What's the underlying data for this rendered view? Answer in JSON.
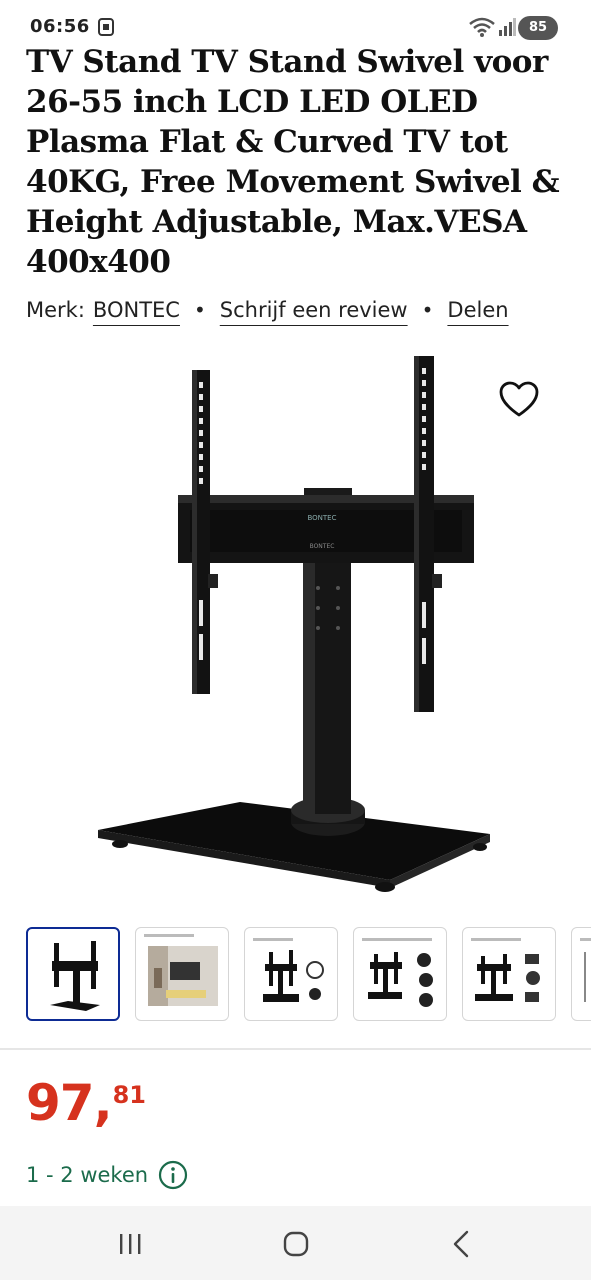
{
  "status_bar": {
    "time": "06:56",
    "battery": "85",
    "icons": [
      "sim-icon",
      "wifi-icon",
      "signal-icon",
      "battery-icon"
    ]
  },
  "product": {
    "title": "TV Stand TV Stand Swivel voor 26-55 inch LCD LED OLED Plasma Flat & Curved TV tot 40KG, Free Movement Swivel & Height Adjustable, Max.VESA 400x400",
    "brand_label": "Merk:",
    "brand": "BONTEC",
    "review_link": "Schrijf een review",
    "share_link": "Delen",
    "separator": "•",
    "image_brand_text": "BONTEC"
  },
  "thumbnails": {
    "count_visible": 6,
    "selected_index": 0
  },
  "price": {
    "integer": "97",
    "separator": ",",
    "decimals": "81",
    "color": "#d6321e"
  },
  "delivery": {
    "text": "1 - 2 weken",
    "color": "#1b6b4b"
  },
  "navbar": {
    "buttons": [
      "recent-apps-icon",
      "home-icon",
      "back-icon"
    ]
  }
}
